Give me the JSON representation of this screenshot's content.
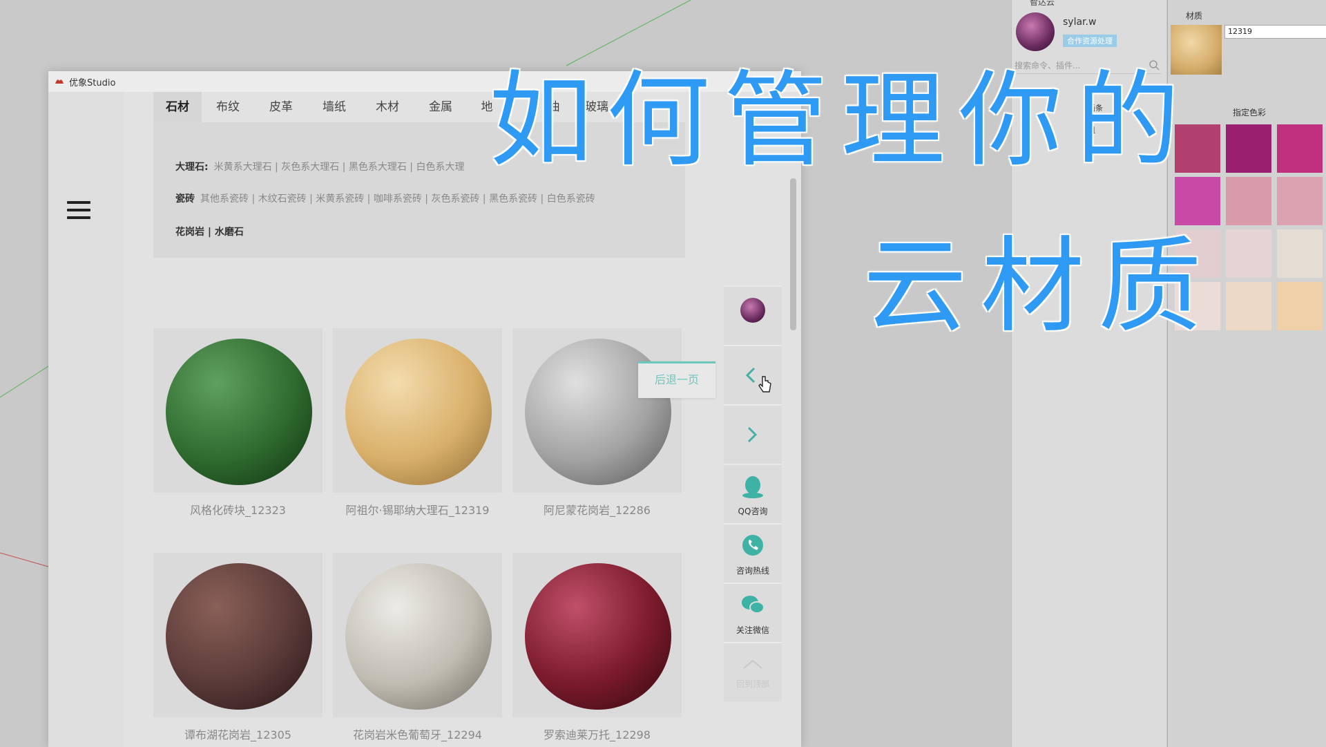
{
  "app": {
    "title": "优象Studio"
  },
  "tabs": [
    "石材",
    "布纹",
    "皮革",
    "墙纸",
    "木材",
    "金属",
    "地",
    "油",
    "玻璃"
  ],
  "active_tab": 0,
  "categories": [
    {
      "label": "大理石:",
      "items": "米黄系大理石 | 灰色系大理石 | 黑色系大理石 | 白色系大理"
    },
    {
      "label": "瓷砖",
      "items": "其他系瓷砖 | 木纹石瓷砖 | 米黄系瓷砖 | 咖啡系瓷砖 | 灰色系瓷砖 | 黑色系瓷砖 | 白色系瓷砖"
    },
    {
      "label": "花岗岩 | 水磨石",
      "items": ""
    }
  ],
  "materials": [
    {
      "name": "风格化砖块_12323",
      "color": "#2f6b2f"
    },
    {
      "name": "阿祖尔·锡耶纳大理石_12319",
      "color": "#d9b06a"
    },
    {
      "name": "阿尼蒙花岗岩_12286",
      "color": "#a3a3a3"
    },
    {
      "name": "谭布湖花岗岩_12305",
      "color": "#5a3a38"
    },
    {
      "name": "花岗岩米色葡萄牙_12294",
      "color": "#c0bcb2"
    },
    {
      "name": "罗索迪莱万托_12298",
      "color": "#7a1a2a"
    }
  ],
  "sidebar": {
    "qq": "QQ咨询",
    "phone": "咨询热线",
    "wechat": "关注微信",
    "top": "回到顶部"
  },
  "tooltip": "后退一页",
  "cloud_panel": {
    "title": "智达云",
    "user": "sylar.w",
    "badge": "合作资源处理",
    "search_placeholder": "搜索命令、插件...",
    "list": [
      "画条",
      "组",
      "好!"
    ]
  },
  "material_panel": {
    "title": "材质",
    "id_value": "12319",
    "color_section": "指定色彩",
    "swatches": [
      "#b2406f",
      "#9a1f6e",
      "#c0307e",
      "#c94aa6",
      "#d99aaa",
      "#dba2b1",
      "#e2cdd0",
      "#e5d3d6",
      "#e5dcd3",
      "#ebdcd8",
      "#ecd9c6",
      "#efd0a8"
    ]
  },
  "headline": {
    "line1": "如何管理你的",
    "line2": "云材质"
  }
}
